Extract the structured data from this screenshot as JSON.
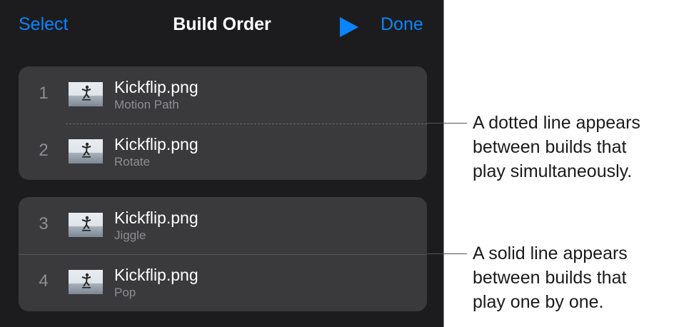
{
  "nav": {
    "select_label": "Select",
    "title": "Build Order",
    "play_icon": "play-icon",
    "done_label": "Done"
  },
  "groups": [
    {
      "separator": "dotted",
      "items": [
        {
          "number": "1",
          "file": "Kickflip.png",
          "effect": "Motion Path"
        },
        {
          "number": "2",
          "file": "Kickflip.png",
          "effect": "Rotate"
        }
      ]
    },
    {
      "separator": "solid",
      "items": [
        {
          "number": "3",
          "file": "Kickflip.png",
          "effect": "Jiggle"
        },
        {
          "number": "4",
          "file": "Kickflip.png",
          "effect": "Pop"
        }
      ]
    }
  ],
  "callouts": {
    "dotted": {
      "lines": [
        "A dotted line appears",
        "between builds that",
        "play simultaneously."
      ]
    },
    "solid": {
      "lines": [
        "A solid line appears",
        "between builds that",
        "play one by one."
      ]
    }
  },
  "colors": {
    "accent": "#0a84ff",
    "panel_background": "#1c1c1e",
    "row_background": "#3a3a3c"
  }
}
